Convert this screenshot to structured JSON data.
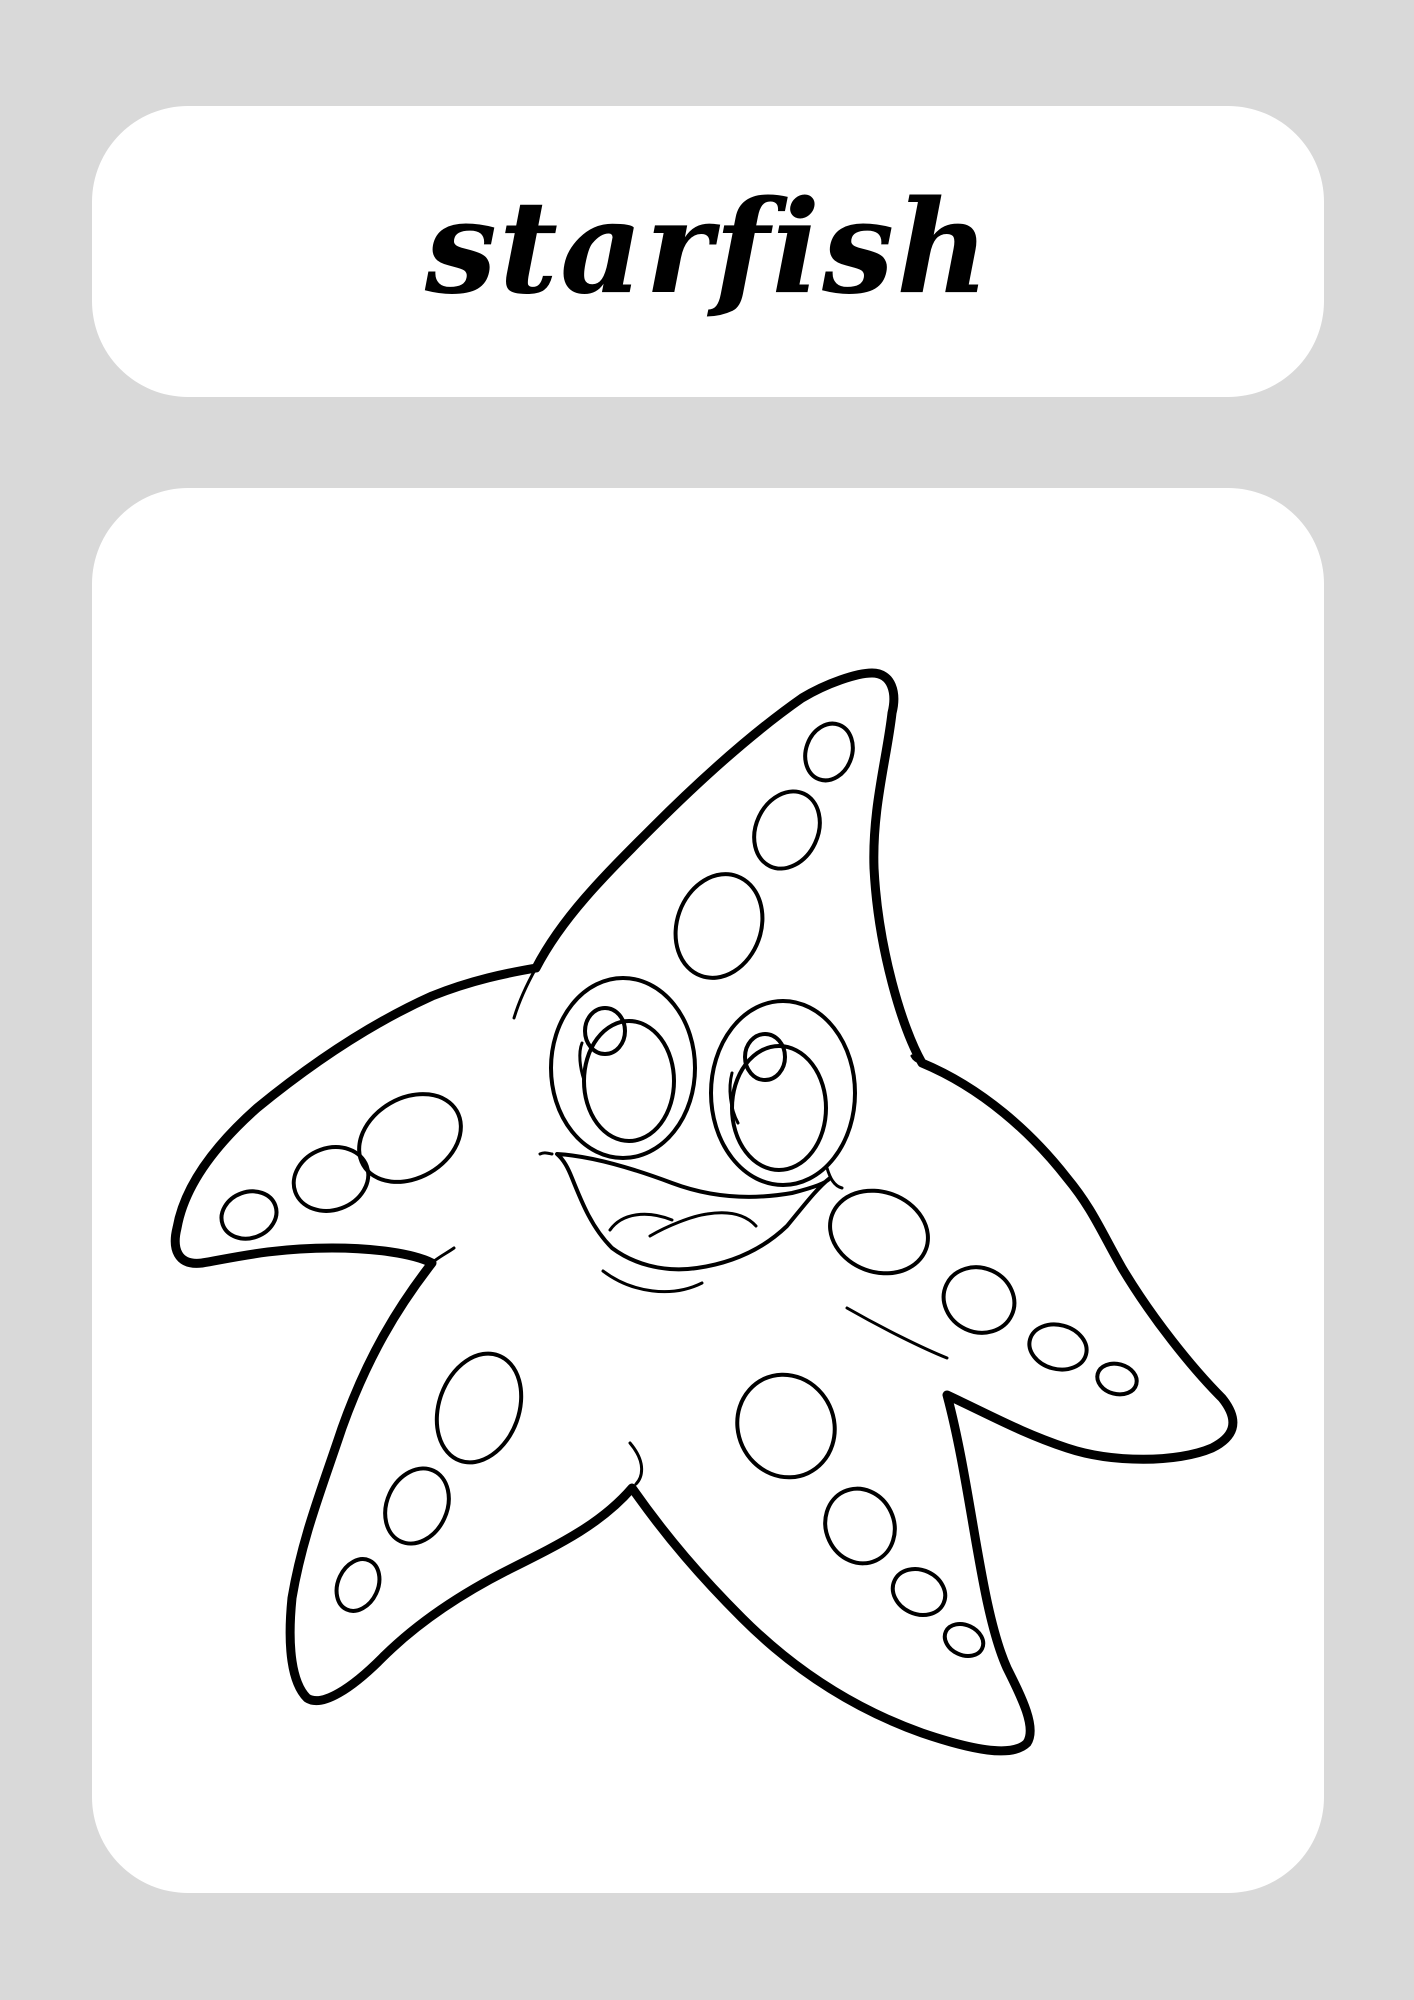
{
  "title": "starfish",
  "illustration": {
    "subject": "starfish-icon",
    "line_color": "#000000",
    "fill_color": "#ffffff"
  },
  "colors": {
    "background": "#d9d9d9",
    "card": "#ffffff",
    "ink": "#000000"
  }
}
